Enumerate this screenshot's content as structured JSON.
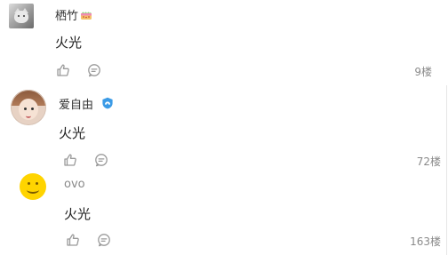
{
  "comments": [
    {
      "username": "栖竹",
      "text": "火光",
      "floor": "9楼"
    },
    {
      "username": "爱自由",
      "text": "火光",
      "floor": "72楼"
    },
    {
      "username": "ovo",
      "text": "火光",
      "floor": "163楼"
    }
  ],
  "icons": {
    "like": "thumbs-up-icon",
    "reply": "reply-bubble-icon",
    "level_badge": "cake-badge-icon",
    "verified_badge": "shield-badge-icon"
  },
  "colors": {
    "action_icon": "#9a9a9a",
    "verified_blue": "#3b9be6",
    "username": "#333333",
    "floor_text": "#8a8a8a"
  }
}
